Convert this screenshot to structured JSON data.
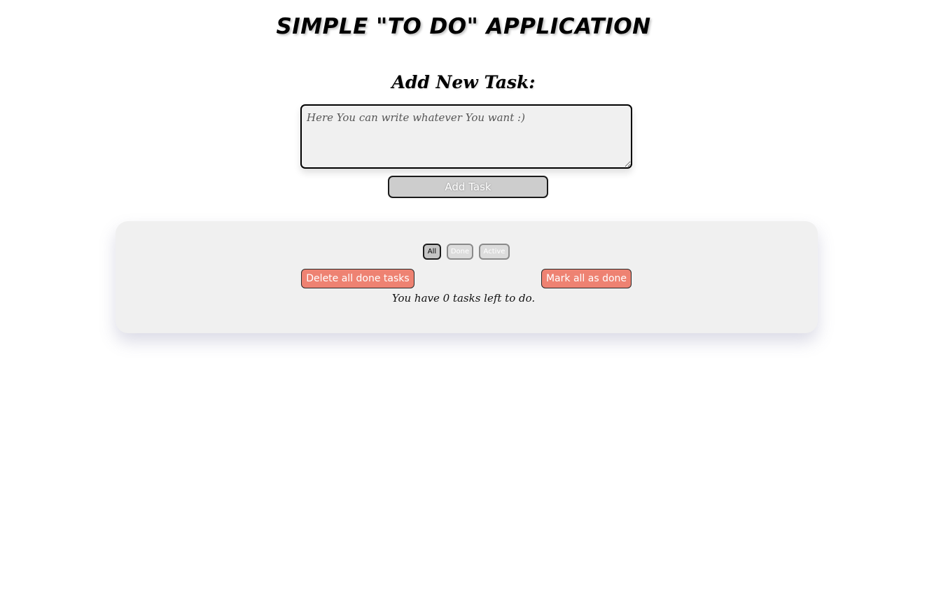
{
  "app": {
    "title": "SIMPLE \"TO DO\" APPLICATION"
  },
  "add_task": {
    "heading": "Add New Task:",
    "textarea_value": "Here You can write whatever You want :)",
    "button_label": "Add Task"
  },
  "filters": {
    "all_label": "All",
    "done_label": "Done",
    "active_label": "Active",
    "selected": "All"
  },
  "actions": {
    "delete_done_label": "Delete all done tasks",
    "mark_all_label": "Mark all as done"
  },
  "status": {
    "tasks_left_text": "You have 0 tasks left to do."
  },
  "colors": {
    "panel_bg": "#f0f0f0",
    "action_button": "#ee8272",
    "add_button": "#cdcdcd"
  }
}
